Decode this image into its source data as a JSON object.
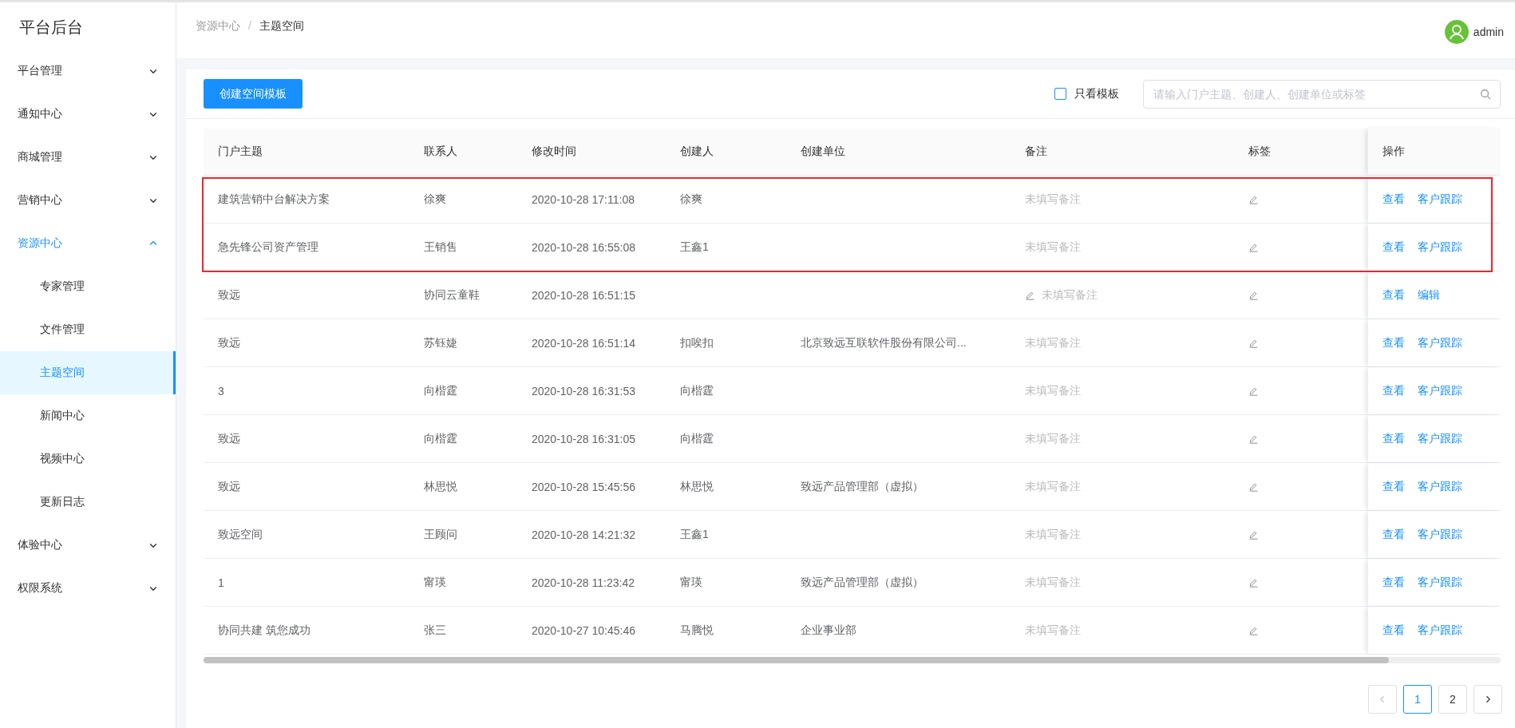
{
  "sidebar": {
    "title": "平台后台",
    "groups": [
      {
        "label": "平台管理",
        "expanded": false,
        "selected": false
      },
      {
        "label": "通知中心",
        "expanded": false,
        "selected": false
      },
      {
        "label": "商城管理",
        "expanded": false,
        "selected": false
      },
      {
        "label": "营销中心",
        "expanded": false,
        "selected": false
      },
      {
        "label": "资源中心",
        "expanded": true,
        "selected": true,
        "children": [
          {
            "label": "专家管理",
            "selected": false
          },
          {
            "label": "文件管理",
            "selected": false
          },
          {
            "label": "主题空间",
            "selected": true
          },
          {
            "label": "新闻中心",
            "selected": false
          },
          {
            "label": "视频中心",
            "selected": false
          },
          {
            "label": "更新日志",
            "selected": false
          }
        ]
      },
      {
        "label": "体验中心",
        "expanded": false,
        "selected": false
      },
      {
        "label": "权限系统",
        "expanded": false,
        "selected": false
      }
    ]
  },
  "breadcrumb": {
    "items": [
      "资源中心",
      "主题空间"
    ],
    "separator": "/"
  },
  "user": {
    "name": "admin"
  },
  "toolbar": {
    "create_button": "创建空间模板",
    "template_only": {
      "label": "只看模板",
      "checked": false
    },
    "search": {
      "placeholder": "请输入门户主题、创建人、创建单位或标签"
    }
  },
  "table": {
    "columns": [
      "门户主题",
      "联系人",
      "修改时间",
      "创建人",
      "创建单位",
      "备注",
      "标签",
      "操作"
    ],
    "rows": [
      {
        "theme": "建筑营销中台解决方案",
        "contact": "徐爽",
        "modified": "2020-10-28 17:11:08",
        "creator": "徐爽",
        "unit": "",
        "remark": "未填写备注",
        "remark_icon": false,
        "actions": [
          "查看",
          "客户跟踪"
        ],
        "highlighted": true
      },
      {
        "theme": "急先锋公司资产管理",
        "contact": "王销售",
        "modified": "2020-10-28 16:55:08",
        "creator": "王鑫1",
        "unit": "",
        "remark": "未填写备注",
        "remark_icon": false,
        "actions": [
          "查看",
          "客户跟踪"
        ],
        "highlighted": true
      },
      {
        "theme": "致远",
        "contact": "协同云童鞋",
        "modified": "2020-10-28 16:51:15",
        "creator": "",
        "unit": "",
        "remark": "未填写备注",
        "remark_icon": true,
        "actions": [
          "查看",
          "编辑"
        ],
        "highlighted": false
      },
      {
        "theme": "致远",
        "contact": "苏钰婕",
        "modified": "2020-10-28 16:51:14",
        "creator": "扣唉扣",
        "unit": "北京致远互联软件股份有限公司...",
        "remark": "未填写备注",
        "remark_icon": false,
        "actions": [
          "查看",
          "客户跟踪"
        ],
        "highlighted": false
      },
      {
        "theme": "3",
        "contact": "向楷霆",
        "modified": "2020-10-28 16:31:53",
        "creator": "向楷霆",
        "unit": "",
        "remark": "未填写备注",
        "remark_icon": false,
        "actions": [
          "查看",
          "客户跟踪"
        ],
        "highlighted": false
      },
      {
        "theme": "致远",
        "contact": "向楷霆",
        "modified": "2020-10-28 16:31:05",
        "creator": "向楷霆",
        "unit": "",
        "remark": "未填写备注",
        "remark_icon": false,
        "actions": [
          "查看",
          "客户跟踪"
        ],
        "highlighted": false
      },
      {
        "theme": "致远",
        "contact": "林思悦",
        "modified": "2020-10-28 15:45:56",
        "creator": "林思悦",
        "unit": "致远产品管理部（虚拟）",
        "remark": "未填写备注",
        "remark_icon": false,
        "actions": [
          "查看",
          "客户跟踪"
        ],
        "highlighted": false
      },
      {
        "theme": "致远空间",
        "contact": "王顾问",
        "modified": "2020-10-28 14:21:32",
        "creator": "王鑫1",
        "unit": "",
        "remark": "未填写备注",
        "remark_icon": false,
        "actions": [
          "查看",
          "客户跟踪"
        ],
        "highlighted": false
      },
      {
        "theme": "1",
        "contact": "甯瑛",
        "modified": "2020-10-28 11:23:42",
        "creator": "甯瑛",
        "unit": "致远产品管理部（虚拟）",
        "remark": "未填写备注",
        "remark_icon": false,
        "actions": [
          "查看",
          "客户跟踪"
        ],
        "highlighted": false
      },
      {
        "theme": "协同共建 筑您成功",
        "contact": "张三",
        "modified": "2020-10-27 10:45:46",
        "creator": "马腾悦",
        "unit": "企业事业部",
        "remark": "未填写备注",
        "remark_icon": false,
        "actions": [
          "查看",
          "客户跟踪"
        ],
        "highlighted": false
      }
    ]
  },
  "pagination": {
    "prev_disabled": true,
    "next_disabled": false,
    "pages": [
      {
        "label": "1",
        "selected": true
      },
      {
        "label": "2",
        "selected": false
      }
    ]
  }
}
